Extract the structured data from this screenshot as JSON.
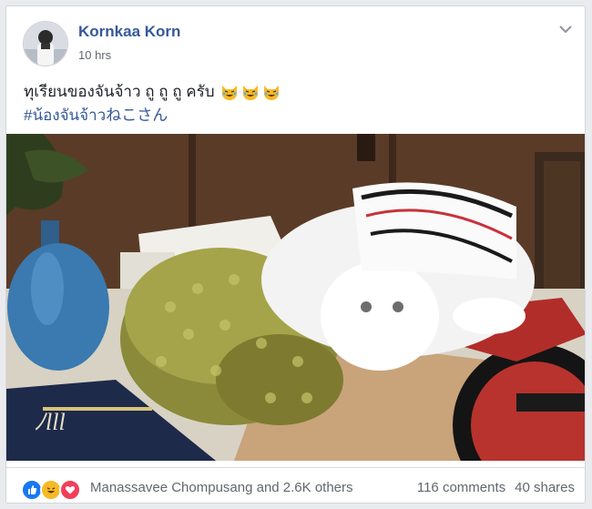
{
  "post": {
    "author": "Kornkaa Korn",
    "time": "10 hrs",
    "text": "ทุเรียนของจันจ้าว ถู ถู ถู ครับ",
    "emojis": [
      "laughing-cat-emoji",
      "laughing-cat-emoji",
      "laughing-cat-emoji"
    ],
    "hashtag": "#น้องจันจ้าวねこさん"
  },
  "media": {
    "description_icons": [
      "durian",
      "white-cat",
      "blue-vase",
      "poster"
    ]
  },
  "footer": {
    "reaction_icons": [
      "like-icon",
      "haha-icon",
      "love-icon"
    ],
    "likers": "Manassavee Chompusang and 2.6K others",
    "comments": "116 comments",
    "shares": "40 shares"
  },
  "colors": {
    "link": "#365899",
    "meta": "#616770",
    "like": "#1877f2",
    "haha": "#f7b928",
    "love": "#f33e58"
  }
}
